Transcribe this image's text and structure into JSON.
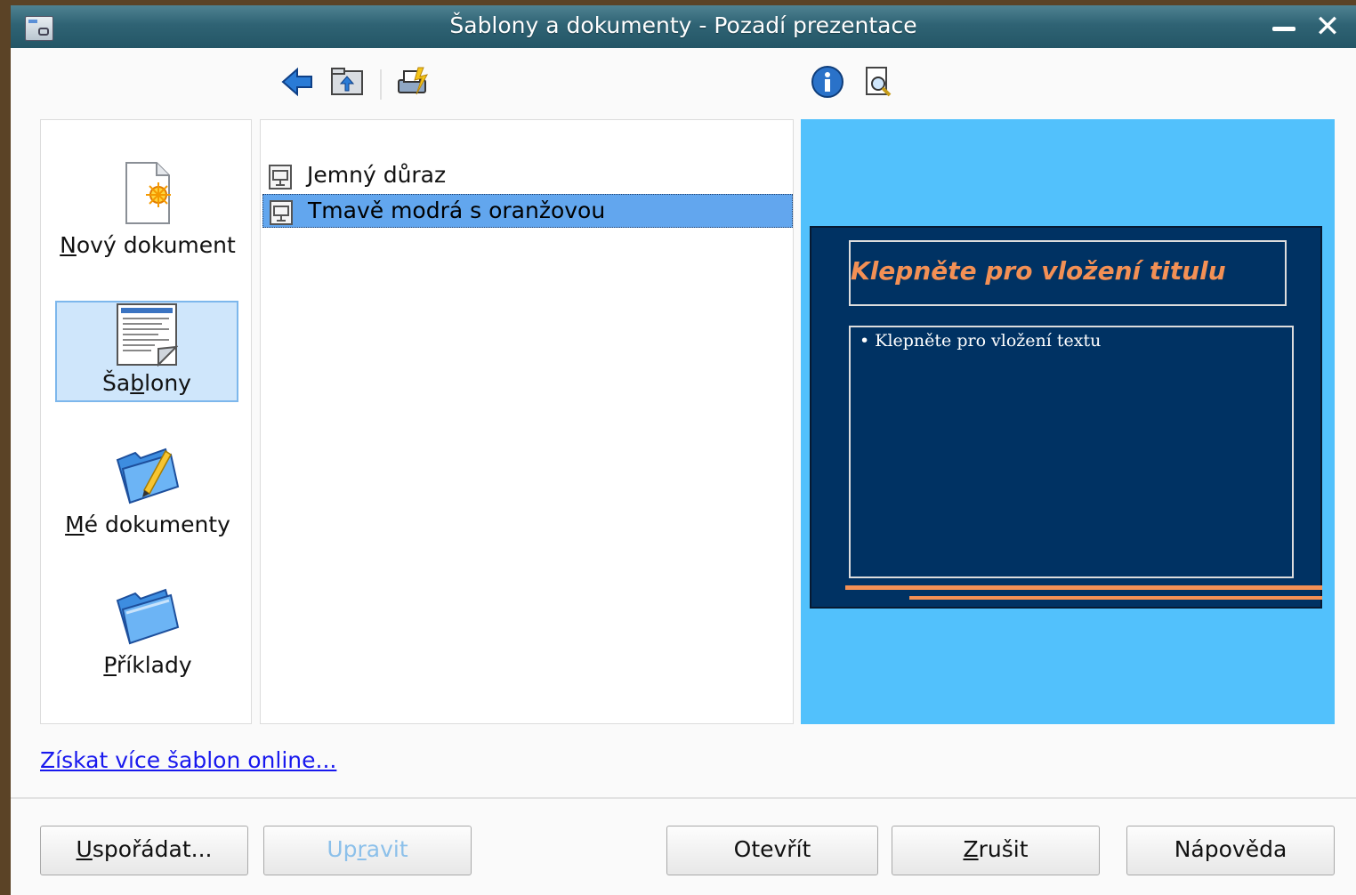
{
  "window": {
    "title": "Šablony a dokumenty - Pozadí prezentace",
    "minimize_icon": "minimize-icon",
    "close_label": "✕"
  },
  "toolbar": {
    "icons": [
      "back-arrow-icon",
      "up-folder-icon",
      "print-icon",
      "info-icon",
      "preview-magnifier-icon"
    ]
  },
  "sidebar": {
    "items": [
      {
        "pre": "",
        "accel": "N",
        "post": "ový dokument",
        "icon": "new-document-icon",
        "selected": false
      },
      {
        "pre": "Ša",
        "accel": "b",
        "post": "lony",
        "icon": "templates-icon",
        "selected": true
      },
      {
        "pre": "",
        "accel": "M",
        "post": "é dokumenty",
        "icon": "my-documents-folder-icon",
        "selected": false
      },
      {
        "pre": "",
        "accel": "P",
        "post": "říklady",
        "icon": "examples-folder-icon",
        "selected": false
      }
    ]
  },
  "templates": {
    "items": [
      {
        "label": "Jemný důraz",
        "selected": false
      },
      {
        "label": "Tmavě modrá s oranžovou",
        "selected": true
      }
    ]
  },
  "preview": {
    "slide_title": "Klepněte pro vložení titulu",
    "slide_body": "• Klepněte pro vložení textu",
    "background": "#52c1fc",
    "slide_bg": "#003263",
    "accent": "#f39055"
  },
  "online_link": "Získat více šablon online...",
  "buttons": {
    "organize": {
      "pre": "",
      "accel": "U",
      "post": "spořádat..."
    },
    "edit": {
      "pre": "Up",
      "accel": "r",
      "post": "avit"
    },
    "open": {
      "label": "Otevřít"
    },
    "cancel": {
      "pre": "",
      "accel": "Z",
      "post": "rušit"
    },
    "help": {
      "label": "Nápověda"
    }
  }
}
